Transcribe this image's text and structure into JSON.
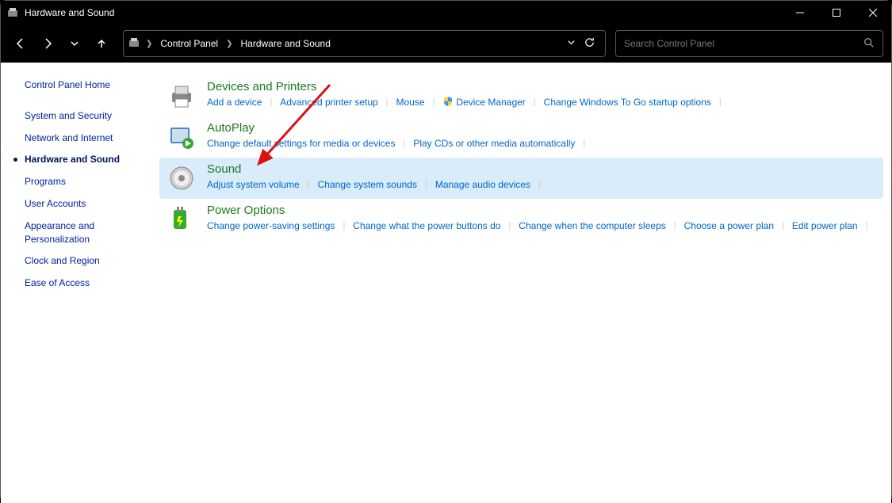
{
  "window": {
    "title": "Hardware and Sound"
  },
  "breadcrumb": {
    "items": [
      "Control Panel",
      "Hardware and Sound"
    ]
  },
  "search": {
    "placeholder": "Search Control Panel"
  },
  "sidebar": {
    "items": [
      {
        "label": "Control Panel Home",
        "active": false
      },
      {
        "label": "System and Security",
        "active": false
      },
      {
        "label": "Network and Internet",
        "active": false
      },
      {
        "label": "Hardware and Sound",
        "active": true
      },
      {
        "label": "Programs",
        "active": false
      },
      {
        "label": "User Accounts",
        "active": false
      },
      {
        "label": "Appearance and Personalization",
        "active": false
      },
      {
        "label": "Clock and Region",
        "active": false
      },
      {
        "label": "Ease of Access",
        "active": false
      }
    ]
  },
  "categories": [
    {
      "title": "Devices and Printers",
      "icon": "printer",
      "highlighted": false,
      "links": [
        {
          "label": "Add a device"
        },
        {
          "label": "Advanced printer setup"
        },
        {
          "label": "Mouse"
        },
        {
          "label": "Device Manager",
          "shield": true
        },
        {
          "label": "Change Windows To Go startup options"
        }
      ]
    },
    {
      "title": "AutoPlay",
      "icon": "autoplay",
      "highlighted": false,
      "links": [
        {
          "label": "Change default settings for media or devices"
        },
        {
          "label": "Play CDs or other media automatically"
        }
      ]
    },
    {
      "title": "Sound",
      "icon": "sound",
      "highlighted": true,
      "links": [
        {
          "label": "Adjust system volume"
        },
        {
          "label": "Change system sounds"
        },
        {
          "label": "Manage audio devices"
        }
      ]
    },
    {
      "title": "Power Options",
      "icon": "power",
      "highlighted": false,
      "links": [
        {
          "label": "Change power-saving settings"
        },
        {
          "label": "Change what the power buttons do"
        },
        {
          "label": "Change when the computer sleeps"
        },
        {
          "label": "Choose a power plan"
        },
        {
          "label": "Edit power plan"
        }
      ]
    }
  ]
}
